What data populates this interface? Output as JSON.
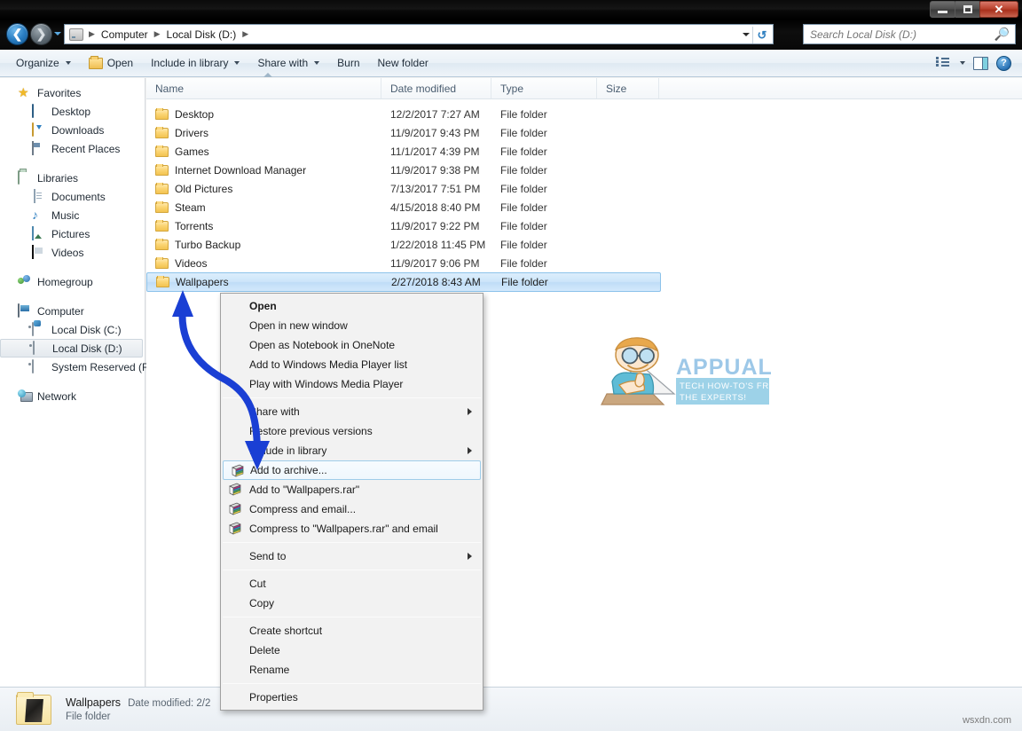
{
  "window": {
    "minimize_label": "Minimize",
    "maximize_label": "Maximize",
    "close_label": "Close"
  },
  "address": {
    "back_label": "Back",
    "forward_label": "Forward",
    "recent_dropdown_label": "Recent pages",
    "crumbs": [
      "Computer",
      "Local Disk (D:)"
    ],
    "separator": "▶",
    "refresh_label": "↺"
  },
  "search": {
    "placeholder": "Search Local Disk (D:)",
    "value": "",
    "icon": "search-icon"
  },
  "toolbar": {
    "items": [
      {
        "label": "Organize",
        "has_caret": true,
        "icon": null
      },
      {
        "label": "Open",
        "has_caret": false,
        "icon": "folder-open-icon"
      },
      {
        "label": "Include in library",
        "has_caret": true,
        "icon": null
      },
      {
        "label": "Share with",
        "has_caret": true,
        "icon": null
      },
      {
        "label": "Burn",
        "has_caret": false,
        "icon": null
      },
      {
        "label": "New folder",
        "has_caret": false,
        "icon": null
      }
    ],
    "view_label": "Change your view",
    "preview_label": "Show the preview pane",
    "help_label": "Get help",
    "help_glyph": "?"
  },
  "sidebar": {
    "groups": [
      {
        "header": {
          "label": "Favorites",
          "icon": "star-icon"
        },
        "items": [
          {
            "label": "Desktop",
            "icon": "desktop-icon"
          },
          {
            "label": "Downloads",
            "icon": "downloads-icon"
          },
          {
            "label": "Recent Places",
            "icon": "recent-places-icon"
          }
        ]
      },
      {
        "header": {
          "label": "Libraries",
          "icon": "libraries-icon"
        },
        "items": [
          {
            "label": "Documents",
            "icon": "document-icon"
          },
          {
            "label": "Music",
            "icon": "music-note-icon"
          },
          {
            "label": "Pictures",
            "icon": "picture-icon"
          },
          {
            "label": "Videos",
            "icon": "video-icon"
          }
        ]
      },
      {
        "header": {
          "label": "Homegroup",
          "icon": "homegroup-icon"
        },
        "items": []
      },
      {
        "header": {
          "label": "Computer",
          "icon": "computer-icon"
        },
        "items": [
          {
            "label": "Local Disk (C:)",
            "icon": "windows-drive-icon",
            "selected": false
          },
          {
            "label": "Local Disk (D:)",
            "icon": "drive-icon",
            "selected": true
          },
          {
            "label": "System Reserved (F:)",
            "icon": "drive-icon",
            "selected": false
          }
        ]
      },
      {
        "header": {
          "label": "Network",
          "icon": "network-icon"
        },
        "items": []
      }
    ]
  },
  "file_list": {
    "columns": [
      "Name",
      "Date modified",
      "Type",
      "Size"
    ],
    "sorted_column": "Name",
    "rows": [
      {
        "name": "Desktop",
        "date": "12/2/2017 7:27 AM",
        "type": "File folder",
        "size": "",
        "selected": false
      },
      {
        "name": "Drivers",
        "date": "11/9/2017 9:43 PM",
        "type": "File folder",
        "size": "",
        "selected": false
      },
      {
        "name": "Games",
        "date": "11/1/2017 4:39 PM",
        "type": "File folder",
        "size": "",
        "selected": false
      },
      {
        "name": "Internet Download Manager",
        "date": "11/9/2017 9:38 PM",
        "type": "File folder",
        "size": "",
        "selected": false
      },
      {
        "name": "Old Pictures",
        "date": "7/13/2017 7:51 PM",
        "type": "File folder",
        "size": "",
        "selected": false
      },
      {
        "name": "Steam",
        "date": "4/15/2018 8:40 PM",
        "type": "File folder",
        "size": "",
        "selected": false
      },
      {
        "name": "Torrents",
        "date": "11/9/2017 9:22 PM",
        "type": "File folder",
        "size": "",
        "selected": false
      },
      {
        "name": "Turbo Backup",
        "date": "1/22/2018 11:45 PM",
        "type": "File folder",
        "size": "",
        "selected": false
      },
      {
        "name": "Videos",
        "date": "11/9/2017 9:06 PM",
        "type": "File folder",
        "size": "",
        "selected": false
      },
      {
        "name": "Wallpapers",
        "date": "2/27/2018 8:43 AM",
        "type": "File folder",
        "size": "",
        "selected": true
      }
    ]
  },
  "context_menu": {
    "items": [
      {
        "label": "Open",
        "bold": true,
        "icon": null,
        "submenu": false,
        "highlighted": false
      },
      {
        "label": "Open in new window",
        "bold": false,
        "icon": null,
        "submenu": false,
        "highlighted": false
      },
      {
        "label": "Open as Notebook in OneNote",
        "bold": false,
        "icon": null,
        "submenu": false,
        "highlighted": false
      },
      {
        "label": "Add to Windows Media Player list",
        "bold": false,
        "icon": null,
        "submenu": false,
        "highlighted": false
      },
      {
        "label": "Play with Windows Media Player",
        "bold": false,
        "icon": null,
        "submenu": false,
        "highlighted": false
      },
      {
        "separator": true
      },
      {
        "label": "Share with",
        "bold": false,
        "icon": null,
        "submenu": true,
        "highlighted": false
      },
      {
        "label": "Restore previous versions",
        "bold": false,
        "icon": null,
        "submenu": false,
        "highlighted": false
      },
      {
        "label": "Include in library",
        "bold": false,
        "icon": null,
        "submenu": true,
        "highlighted": false
      },
      {
        "label": "Add to archive...",
        "bold": false,
        "icon": "winrar-icon",
        "submenu": false,
        "highlighted": true
      },
      {
        "label": "Add to \"Wallpapers.rar\"",
        "bold": false,
        "icon": "winrar-icon",
        "submenu": false,
        "highlighted": false
      },
      {
        "label": "Compress and email...",
        "bold": false,
        "icon": "winrar-icon",
        "submenu": false,
        "highlighted": false
      },
      {
        "label": "Compress to \"Wallpapers.rar\" and email",
        "bold": false,
        "icon": "winrar-icon",
        "submenu": false,
        "highlighted": false
      },
      {
        "separator": true
      },
      {
        "label": "Send to",
        "bold": false,
        "icon": null,
        "submenu": true,
        "highlighted": false
      },
      {
        "separator": true
      },
      {
        "label": "Cut",
        "bold": false,
        "icon": null,
        "submenu": false,
        "highlighted": false
      },
      {
        "label": "Copy",
        "bold": false,
        "icon": null,
        "submenu": false,
        "highlighted": false
      },
      {
        "separator": true
      },
      {
        "label": "Create shortcut",
        "bold": false,
        "icon": null,
        "submenu": false,
        "highlighted": false
      },
      {
        "label": "Delete",
        "bold": false,
        "icon": null,
        "submenu": false,
        "highlighted": false
      },
      {
        "label": "Rename",
        "bold": false,
        "icon": null,
        "submenu": false,
        "highlighted": false
      },
      {
        "separator": true
      },
      {
        "label": "Properties",
        "bold": false,
        "icon": null,
        "submenu": false,
        "highlighted": false
      }
    ]
  },
  "status_bar": {
    "name": "Wallpapers",
    "meta": "Date modified: 2/2",
    "type": "File folder"
  },
  "annotation": {
    "arrow_color": "#1a3fd4",
    "description": "curved double-headed arrow from Add to archive to Wallpapers row"
  },
  "watermark": {
    "brand": "APPUALS",
    "tagline_line1": "TECH HOW-TO'S FROM",
    "tagline_line2": "THE EXPERTS!",
    "site": "wsxdn.com",
    "brand_color": "#9dc8e8",
    "banner_color": "#9dd2e8"
  }
}
